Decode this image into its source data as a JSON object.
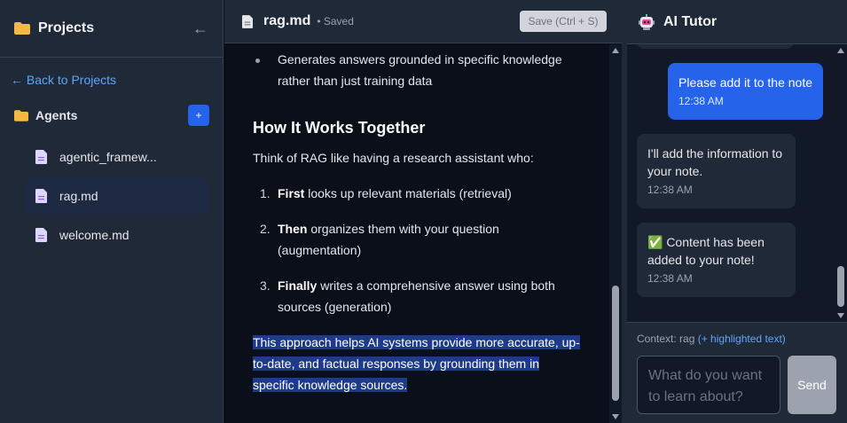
{
  "sidebar": {
    "title": "Projects",
    "collapse_icon": "←",
    "back_link": "← Back to Projects",
    "folder_name": "Agents",
    "add_label": "+",
    "files": [
      {
        "name": "agentic_framew..."
      },
      {
        "name": "rag.md"
      },
      {
        "name": "welcome.md"
      }
    ]
  },
  "editor": {
    "filename": "rag.md",
    "status": "• Saved",
    "save_label": "Save (Ctrl + S)",
    "bullet": "Generates answers grounded in specific knowledge rather than just training data",
    "heading": "How It Works Together",
    "intro": "Think of RAG like having a research assistant who:",
    "steps": [
      {
        "num": "1.",
        "bold": "First",
        "text": " looks up relevant materials (retrieval)"
      },
      {
        "num": "2.",
        "bold": "Then",
        "text": " organizes them with your question (augmentation)"
      },
      {
        "num": "3.",
        "bold": "Finally",
        "text": " writes a comprehensive answer using both sources (generation)"
      }
    ],
    "highlighted": "This approach helps AI systems provide more accurate, up-to-date, and factual responses by grounding them in specific knowledge sources."
  },
  "tutor": {
    "title": "AI Tutor",
    "messages": [
      {
        "role": "user",
        "text": "Please add it to the note",
        "time": "12:38 AM"
      },
      {
        "role": "bot",
        "text": "I'll add the information to your note.",
        "time": "12:38 AM"
      },
      {
        "role": "bot",
        "text": "✅ Content has been added to your note!",
        "time": "12:38 AM"
      }
    ],
    "context_label": "Context: rag",
    "context_extra": "(+ highlighted text)",
    "input_placeholder": "What do you want to learn about?",
    "send_label": "Send"
  },
  "colors": {
    "accent": "#2563eb",
    "link": "#60a5fa",
    "highlight": "#1e3a8a",
    "folder": "#f5b942"
  },
  "icons": {
    "folder": "folder-icon",
    "file": "file-icon",
    "bot": "robot-icon"
  }
}
